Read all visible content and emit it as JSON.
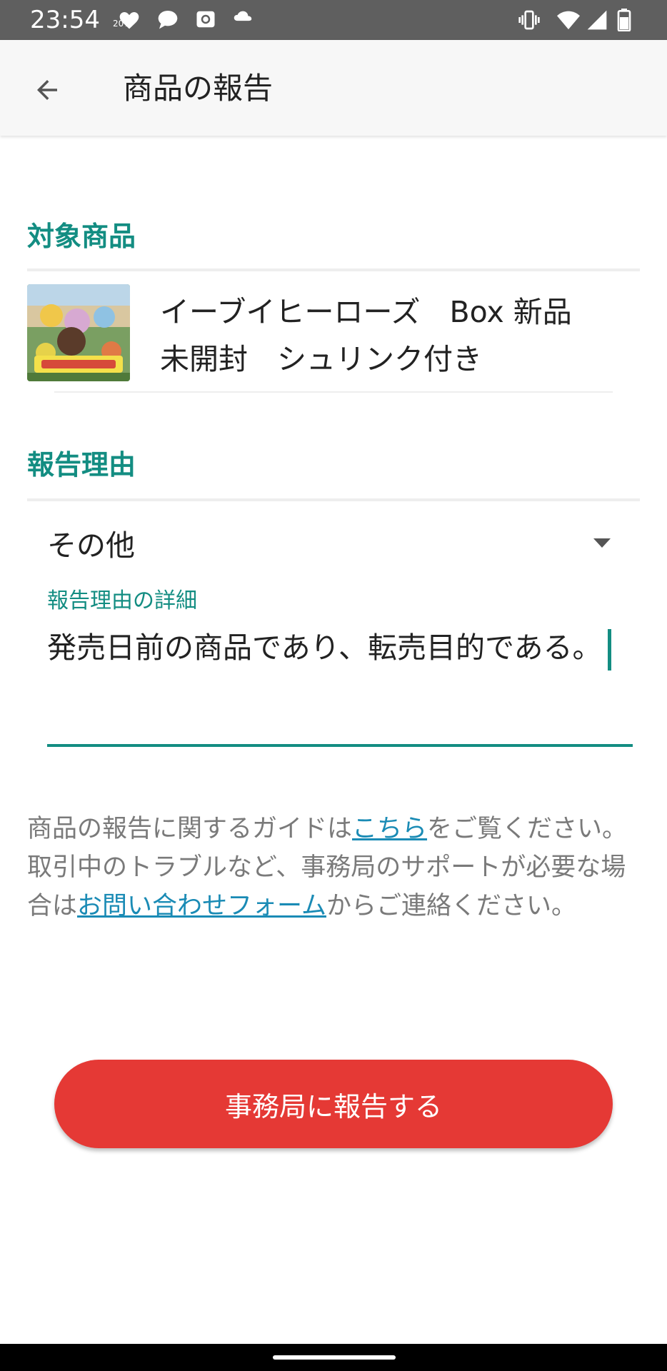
{
  "status_bar": {
    "time": "23:54",
    "battery_percent_label": "20%",
    "icons": [
      "heart-icon",
      "chat-bubble-icon",
      "camera-icon",
      "weather-icon",
      "vibrate-icon",
      "wifi-icon",
      "signal-icon",
      "battery-icon"
    ]
  },
  "app_bar": {
    "title": "商品の報告",
    "back_icon": "arrow-left-icon"
  },
  "target_section": {
    "label": "対象商品",
    "product_name_line1": "イーブイヒーローズ　Box 新品",
    "product_name_line2": "未開封　シュリンク付き"
  },
  "reason_section": {
    "label": "報告理由",
    "selected_reason": "その他",
    "detail_label": "報告理由の詳細",
    "detail_value": "発売日前の商品であり、転売目的である。"
  },
  "guide": {
    "part1": "商品の報告に関するガイドは",
    "link1": "こちら",
    "part2": "をご覧ください。",
    "part3": "取引中のトラブルなど、事務局のサポートが必要な場合は",
    "link2": "お問い合わせフォーム",
    "part4": "からご連絡ください。"
  },
  "report_button_label": "事務局に報告する",
  "colors": {
    "accent": "#138d82",
    "button": "#e53935",
    "link": "#1a8bb5"
  }
}
